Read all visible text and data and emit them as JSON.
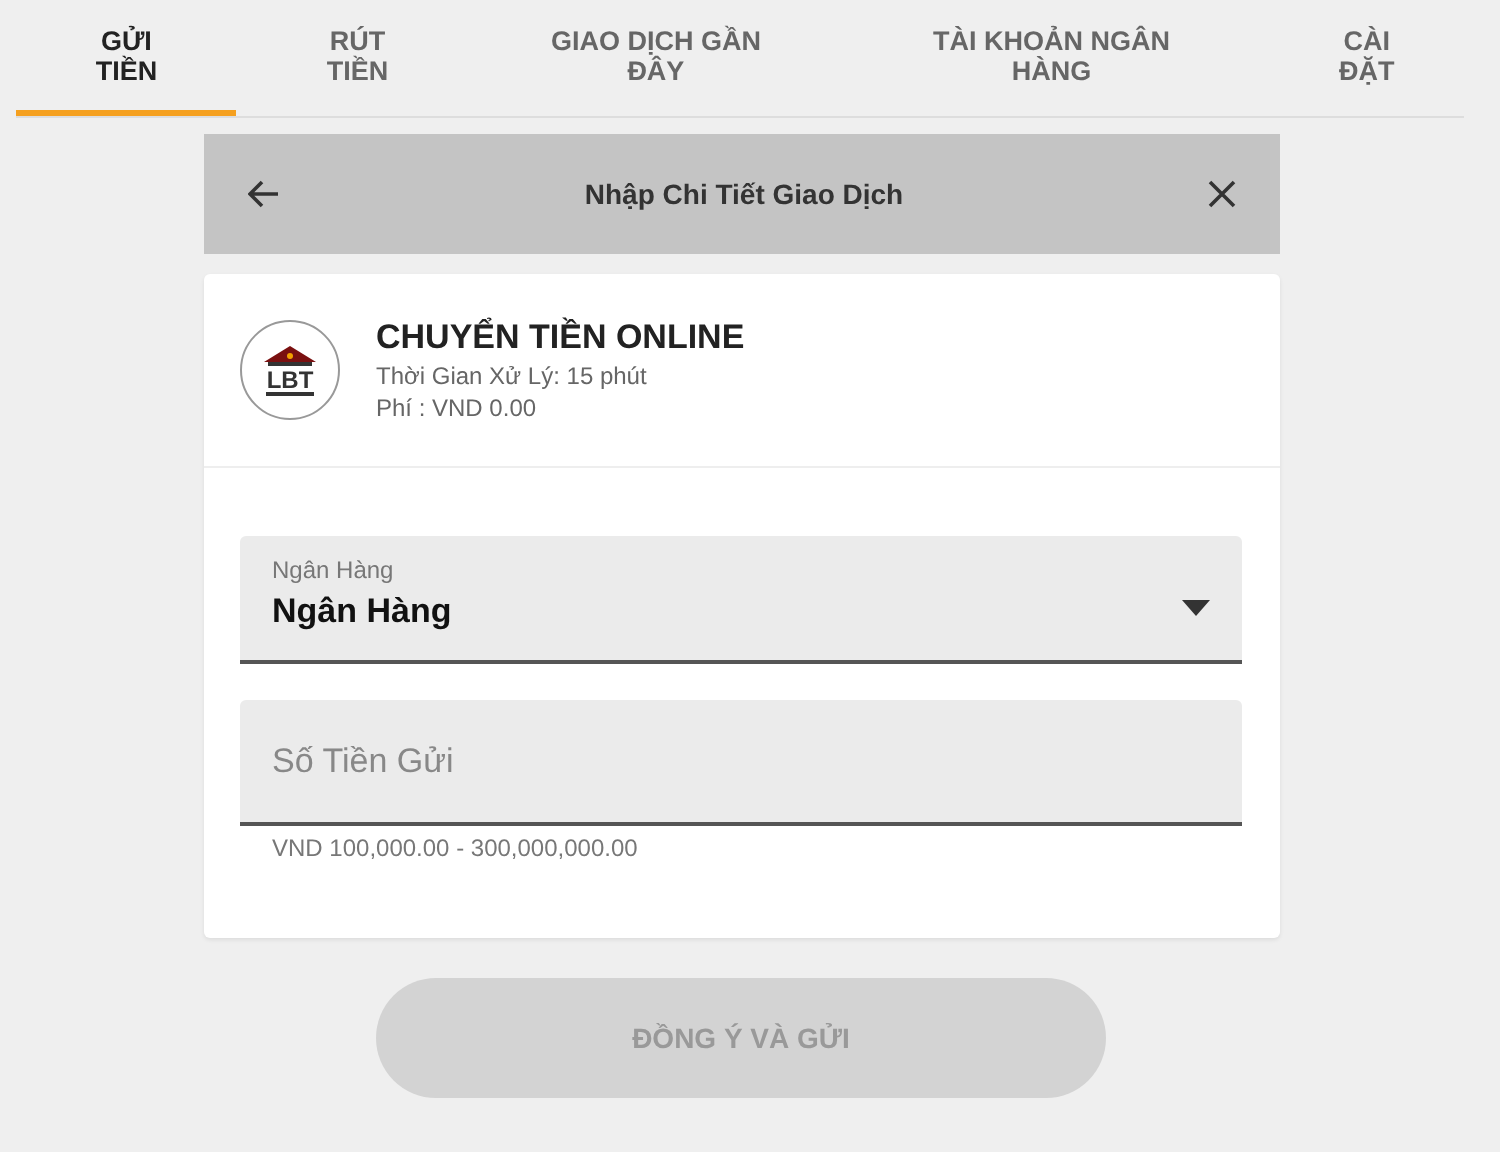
{
  "tabs": [
    {
      "label": "GỬI TIỀN",
      "selected": true
    },
    {
      "label": "RÚT TIỀN",
      "selected": false
    },
    {
      "label": "GIAO DỊCH GẦN ĐÂY",
      "selected": false
    },
    {
      "label": "TÀI KHOẢN NGÂN HÀNG",
      "selected": false
    },
    {
      "label": "CÀI ĐẶT",
      "selected": false
    }
  ],
  "dialog": {
    "title": "Nhập Chi Tiết Giao Dịch",
    "method": {
      "logo_text": "LBT",
      "name": "CHUYỂN TIỀN ONLINE",
      "processing_time": "Thời Gian Xử Lý: 15 phút",
      "fee": "Phí : VND 0.00"
    },
    "bank_select": {
      "label": "Ngân Hàng",
      "value": "Ngân Hàng"
    },
    "amount_field": {
      "placeholder": "Số Tiền Gửi",
      "hint": "VND 100,000.00 - 300,000,000.00"
    },
    "submit": {
      "label": "ĐỒNG Ý VÀ GỬI",
      "disabled": true
    }
  }
}
